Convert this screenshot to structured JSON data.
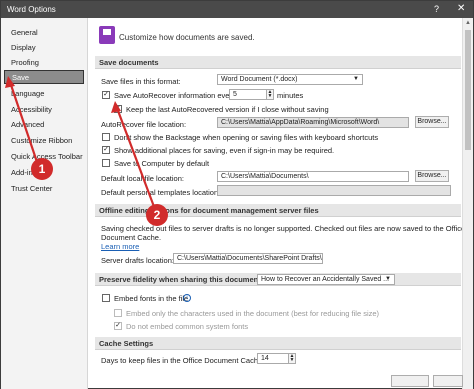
{
  "window": {
    "title": "Word Options",
    "help_glyph": "?",
    "close_glyph": "✕"
  },
  "sidebar": {
    "items": [
      {
        "label": "General"
      },
      {
        "label": "Display"
      },
      {
        "label": "Proofing"
      },
      {
        "label": "Save",
        "active": true
      },
      {
        "label": "Language"
      },
      {
        "label": "Accessibility"
      },
      {
        "label": "Advanced"
      },
      {
        "label": "Customize Ribbon"
      },
      {
        "label": "Quick Access Toolbar"
      },
      {
        "label": "Add-ins"
      },
      {
        "label": "Trust Center"
      }
    ]
  },
  "main": {
    "header": "Customize how documents are saved.",
    "save_documents": {
      "title": "Save documents",
      "format_label": "Save files in this format:",
      "format_value": "Word Document (*.docx)",
      "autorecover_label": "Save AutoRecover information every",
      "autorecover_minutes": "5",
      "minutes_label": "minutes",
      "keep_last_label": "Keep the last AutoRecovered version if I close without saving",
      "ar_location_label": "AutoRecover file location:",
      "ar_location_value": "C:\\Users\\Mattia\\AppData\\Roaming\\Microsoft\\Word\\",
      "browse": "Browse...",
      "backstage_label": "Don't show the Backstage when opening or saving files with keyboard shortcuts",
      "additional_places_label": "Show additional places for saving, even if sign-in may be required.",
      "save_computer_label": "Save to Computer by default",
      "default_local_label": "Default local file location:",
      "default_local_value": "C:\\Users\\Mattia\\Documents\\",
      "default_templates_label": "Default personal templates location:",
      "default_templates_value": ""
    },
    "offline": {
      "title": "Offline editing options for document management server files",
      "desc_line1": "Saving checked out files to server drafts is no longer supported. Checked out files are now saved to the Office",
      "desc_line2": "Document Cache.",
      "learn_more": "Learn more",
      "server_drafts_label": "Server drafts location:",
      "server_drafts_value": "C:\\Users\\Mattia\\Documents\\SharePoint Drafts\\"
    },
    "fidelity": {
      "title": "Preserve fidelity when sharing this document:",
      "doc_value": "How to Recover an Accidentally Saved ...",
      "embed_fonts_label": "Embed fonts in the file",
      "embed_only_label": "Embed only the characters used in the document (best for reducing file size)",
      "no_common_label": "Do not embed common system fonts"
    },
    "cache": {
      "title": "Cache Settings",
      "days_label": "Days to keep files in the Office Document Cache:",
      "days_value": "14"
    }
  },
  "buttons": {
    "browse_label": "Browse..."
  },
  "annotations": [
    {
      "label": "1"
    },
    {
      "label": "2"
    }
  ],
  "colors": {
    "annotation_red": "#d12b2b",
    "word_purple": "#8a3ab9",
    "active_sidebar": "#8c8c8c"
  }
}
